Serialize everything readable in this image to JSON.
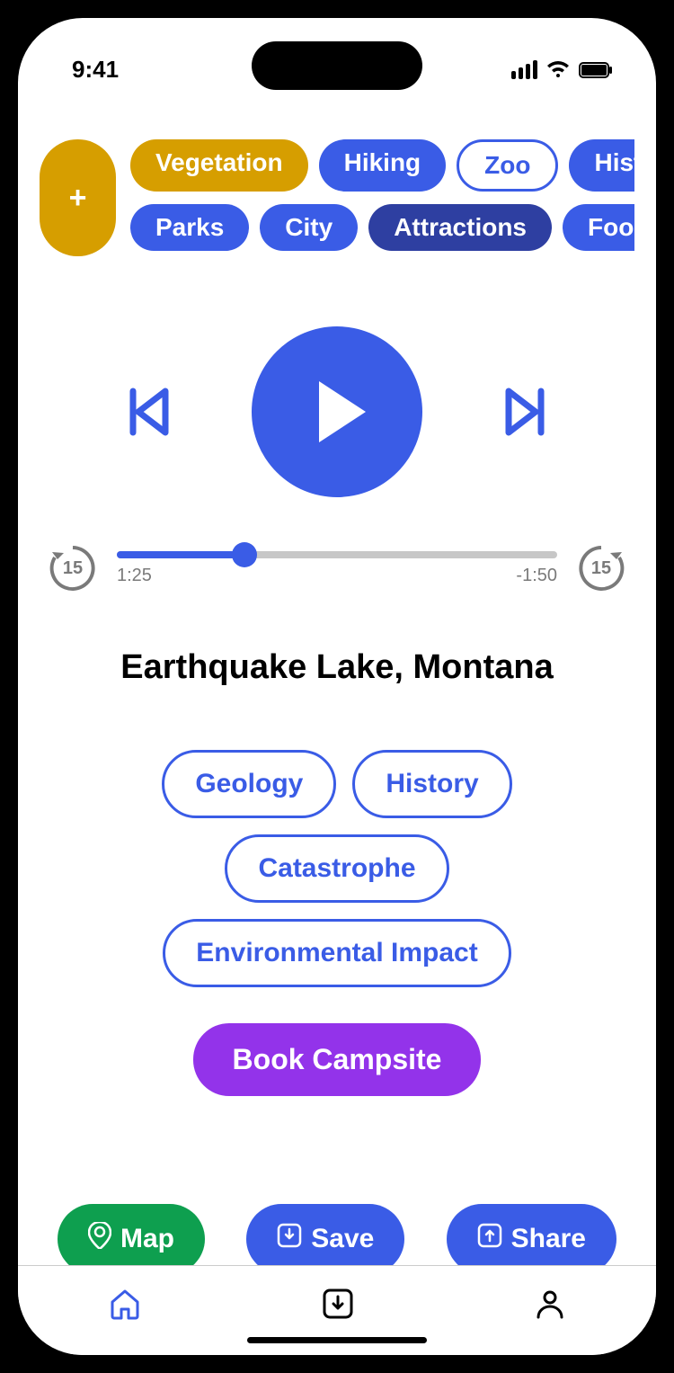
{
  "status": {
    "time": "9:41"
  },
  "chips": {
    "add_label": "+",
    "row1": [
      {
        "label": "Vegetation",
        "style": "gold"
      },
      {
        "label": "Hiking",
        "style": "blue"
      },
      {
        "label": "Zoo",
        "style": "outline"
      },
      {
        "label": "Historic",
        "style": "blue"
      }
    ],
    "row2": [
      {
        "label": "Parks",
        "style": "blue"
      },
      {
        "label": "City",
        "style": "blue"
      },
      {
        "label": "Attractions",
        "style": "darkblue"
      },
      {
        "label": "Food",
        "style": "blue"
      }
    ]
  },
  "player": {
    "rewind_seconds": "15",
    "forward_seconds": "15",
    "elapsed": "1:25",
    "remaining": "-1:50",
    "progress_pct": 29
  },
  "title": "Earthquake Lake, Montana",
  "topics": [
    "Geology",
    "History",
    "Catastrophe",
    "Environmental Impact"
  ],
  "cta": "Book Campsite",
  "actions": {
    "map": "Map",
    "save": "Save",
    "share": "Share"
  },
  "colors": {
    "primary_blue": "#3A5CE6",
    "dark_blue": "#2E3FA1",
    "gold": "#D69E00",
    "purple": "#9333EA",
    "green": "#0E9F4F"
  }
}
